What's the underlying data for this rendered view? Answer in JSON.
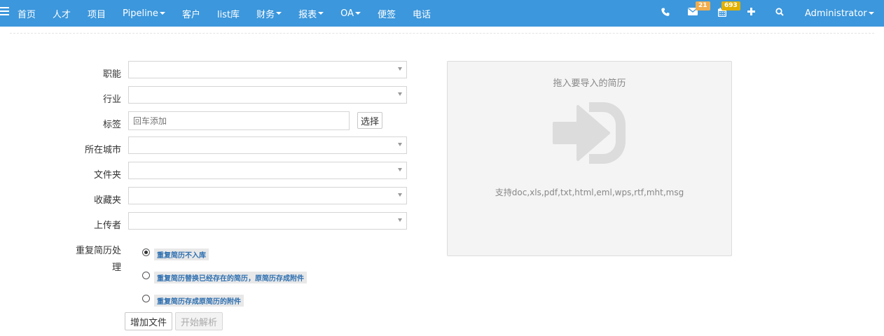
{
  "nav": {
    "items": [
      {
        "label": "首页",
        "dropdown": false
      },
      {
        "label": "人才",
        "dropdown": false
      },
      {
        "label": "项目",
        "dropdown": false
      },
      {
        "label": "Pipeline",
        "dropdown": true
      },
      {
        "label": "客户",
        "dropdown": false
      },
      {
        "label": "list库",
        "dropdown": false
      },
      {
        "label": "财务",
        "dropdown": true
      },
      {
        "label": "报表",
        "dropdown": true
      },
      {
        "label": "OA",
        "dropdown": true
      },
      {
        "label": "便签",
        "dropdown": false
      },
      {
        "label": "电话",
        "dropdown": false
      }
    ],
    "mail_badge": "21",
    "calendar_badge": "693",
    "user": "Administrator",
    "colors": {
      "bar": "#3c97dc",
      "mail_badge": "#f0ad4e",
      "calendar_badge": "#e0b000"
    }
  },
  "form": {
    "labels": {
      "function": "职能",
      "industry": "行业",
      "tags": "标签",
      "city": "所在城市",
      "folder": "文件夹",
      "favorites": "收藏夹",
      "uploader": "上传者",
      "dup_line1": "重复简历处",
      "dup_line2": "理"
    },
    "tag_placeholder": "回车添加",
    "select_button": "选择",
    "duplicate_options": [
      {
        "label": "重复简历不入库",
        "checked": true
      },
      {
        "label": "重复简历替换已经存在的简历，原简历存成附件",
        "checked": false
      },
      {
        "label": "重复简历存成原简历的附件",
        "checked": false
      }
    ],
    "add_file_button": "增加文件",
    "start_parse_button": "开始解析"
  },
  "dropzone": {
    "title": "拖入要导入的简历",
    "supported": "支持doc,xls,pdf,txt,html,eml,wps,rtf,mht,msg",
    "icon": "sign-in-icon"
  }
}
